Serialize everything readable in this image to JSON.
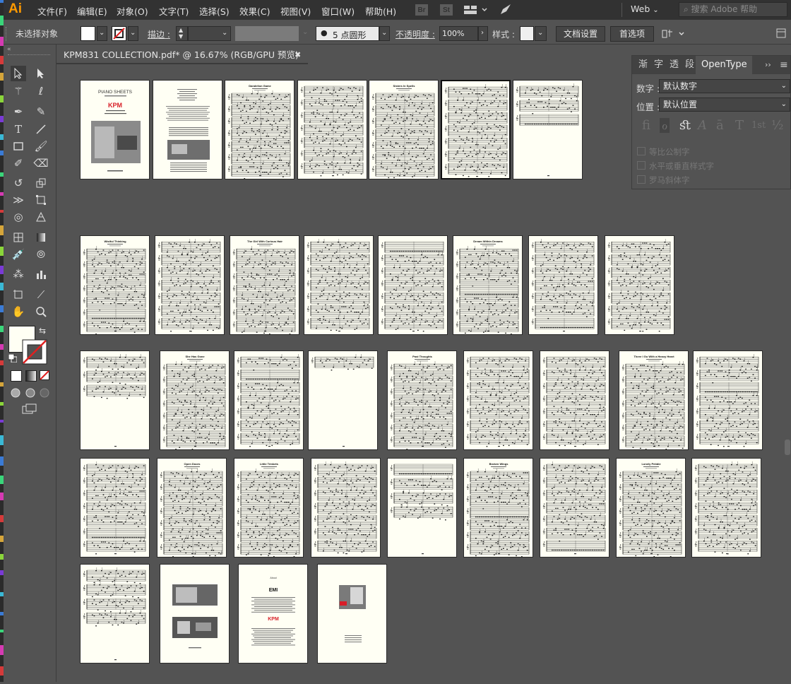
{
  "app": {
    "logo": "Ai",
    "menu": [
      "文件(F)",
      "编辑(E)",
      "对象(O)",
      "文字(T)",
      "选择(S)",
      "效果(C)",
      "视图(V)",
      "窗口(W)",
      "帮助(H)"
    ],
    "bridge": "Br",
    "stock": "St",
    "workspace": "Web",
    "help_placeholder": "搜索 Adobe 帮助"
  },
  "control": {
    "selection": "未选择对象",
    "stroke_label": "描边 :",
    "brush": "5 点圆形",
    "opacity_label": "不透明度 :",
    "opacity_value": "100%",
    "style_label": "样式 :",
    "doc_setup": "文档设置",
    "prefs": "首选项"
  },
  "document": {
    "tab_title": "KPM831 COLLECTION.pdf* @ 16.67% (RGB/GPU 预览)"
  },
  "artboards": {
    "row1": [
      {
        "type": "cover",
        "title": "PIANO SHEETS",
        "brand": "KPM"
      },
      {
        "type": "credits"
      },
      {
        "type": "music",
        "title": "Dandelion Game"
      },
      {
        "type": "music",
        "title": ""
      },
      {
        "type": "music",
        "title": "Sisters In Spells"
      },
      {
        "type": "music",
        "title": "",
        "selected": true
      },
      {
        "type": "music-short",
        "title": ""
      }
    ],
    "row2": [
      {
        "type": "music",
        "title": "Wistful Thinking"
      },
      {
        "type": "music",
        "title": ""
      },
      {
        "type": "music",
        "title": "The Girl With Curious Hair"
      },
      {
        "type": "music",
        "title": ""
      },
      {
        "type": "music",
        "title": ""
      },
      {
        "type": "music",
        "title": "Dream Within Dreams"
      },
      {
        "type": "music",
        "title": ""
      },
      {
        "type": "music",
        "title": ""
      }
    ],
    "row3": [
      {
        "type": "music-short",
        "title": ""
      },
      {
        "type": "music",
        "title": "She Has Gone"
      },
      {
        "type": "music",
        "title": ""
      },
      {
        "type": "music-one",
        "title": ""
      },
      {
        "type": "music",
        "title": "Past Thoughts"
      },
      {
        "type": "music",
        "title": ""
      },
      {
        "type": "music",
        "title": ""
      },
      {
        "type": "music",
        "title": "There I Go With a Heavy Heart"
      },
      {
        "type": "music",
        "title": ""
      }
    ],
    "row4": [
      {
        "type": "music",
        "title": ""
      },
      {
        "type": "music",
        "title": "Open Doors"
      },
      {
        "type": "music",
        "title": "Little Trinkets"
      },
      {
        "type": "music",
        "title": ""
      },
      {
        "type": "music-half",
        "title": ""
      },
      {
        "type": "music",
        "title": "Broken Wings"
      },
      {
        "type": "music",
        "title": ""
      },
      {
        "type": "music",
        "title": "Lonely Pebble"
      },
      {
        "type": "music",
        "title": ""
      }
    ],
    "row5": [
      {
        "type": "music-half",
        "title": ""
      },
      {
        "type": "photos"
      },
      {
        "type": "about",
        "title": "About",
        "brand1": "EMI",
        "brand2": "KPM"
      },
      {
        "type": "back"
      }
    ]
  },
  "panel": {
    "tabs": [
      "渐",
      "字",
      "透",
      "段",
      "OpenType"
    ],
    "number_label": "数字 :",
    "number_value": "默认数字",
    "position_label": "位置 :",
    "position_value": "默认位置",
    "glyphs": [
      "ﬁ",
      "ℴ",
      "ﬆ",
      "A",
      "ā",
      "T",
      "1st",
      "½"
    ],
    "opt1": "等比公制字",
    "opt2": "水平或垂直样式字",
    "opt3": "罗马斜体字"
  },
  "colors": {
    "accent": "#ff9a00",
    "page": "#fffff4",
    "panel_bg": "#535353",
    "menubar_bg": "#323232"
  }
}
